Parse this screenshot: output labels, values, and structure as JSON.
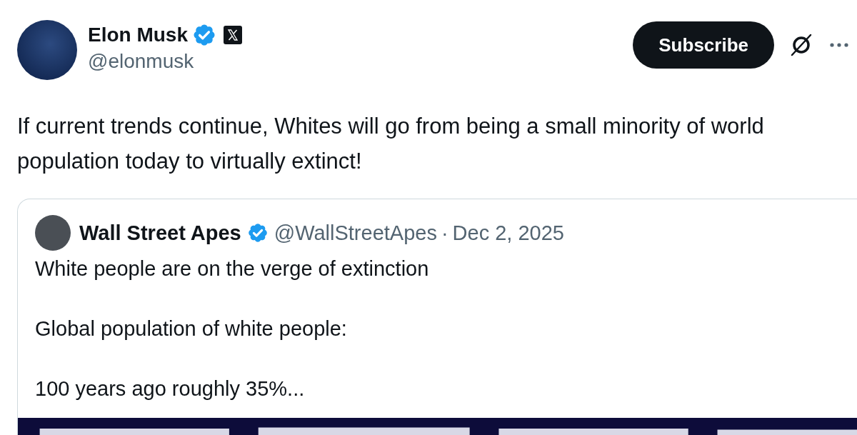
{
  "post": {
    "author": {
      "name": "Elon Musk",
      "handle": "@elonmusk",
      "verified": true,
      "affiliate_badge": true
    },
    "subscribe_button": "Subscribe",
    "text": "If current trends continue, Whites will go from being a small minority of world population today to virtually extinct!",
    "quoted_post": {
      "author": {
        "name": "Wall Street Apes",
        "handle": "@WallStreetApes",
        "verified": true
      },
      "separator": "·",
      "date": "Dec 2, 2025",
      "paragraphs": [
        "White people are on the verge of extinction",
        "Global population of white people:",
        "100 years ago roughly 35%..."
      ]
    }
  }
}
